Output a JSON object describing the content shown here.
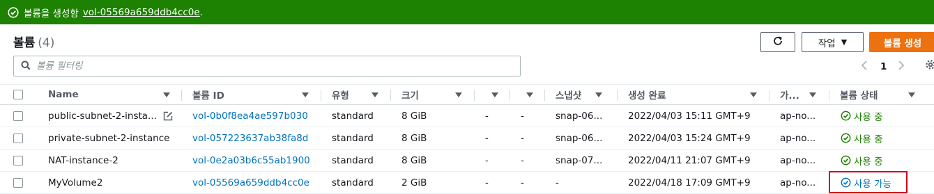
{
  "flash": {
    "message": "볼륨을 생성함",
    "volume_link": "vol-05569a659ddb4cc0e",
    "suffix": "."
  },
  "header": {
    "title": "볼륨",
    "count": "(4)"
  },
  "toolbar": {
    "actions_label": "작업",
    "create_label": "볼륨 생성"
  },
  "search": {
    "placeholder": "볼륨 필터링"
  },
  "pagination": {
    "current": "1"
  },
  "columns": [
    "Name",
    "볼륨 ID",
    "유형",
    "크기",
    "",
    "",
    "스냅샷",
    "생성 완료",
    "가...",
    "볼륨 상태"
  ],
  "rows": [
    {
      "name": "public-subnet-2-insta...",
      "id": "vol-0b0f8ea4ae597b030",
      "type": "standard",
      "size": "8 GiB",
      "c5": "-",
      "c6": "-",
      "snapshot": "snap-06...",
      "created": "2022/04/03 15:11 GMT+9",
      "az": "ap-no...",
      "state": "사용 중"
    },
    {
      "name": "private-subnet-2-instance",
      "id": "vol-057223637ab38fa8d",
      "type": "standard",
      "size": "8 GiB",
      "c5": "-",
      "c6": "-",
      "snapshot": "snap-06...",
      "created": "2022/04/03 15:24 GMT+9",
      "az": "ap-no...",
      "state": "사용 중"
    },
    {
      "name": "NAT-instance-2",
      "id": "vol-0e2a03b6c55ab1900",
      "type": "standard",
      "size": "8 GiB",
      "c5": "-",
      "c6": "-",
      "snapshot": "snap-07...",
      "created": "2022/04/11 21:07 GMT+9",
      "az": "ap-no...",
      "state": "사용 중"
    },
    {
      "name": "MyVolume2",
      "id": "vol-05569a659ddb4cc0e",
      "type": "standard",
      "size": "2 GiB",
      "c5": "-",
      "c6": "-",
      "snapshot": "-",
      "created": "2022/04/18 17:09 GMT+9",
      "az": "ap-no...",
      "state": "사용 가능"
    }
  ],
  "colors": {
    "success": "#1d8102",
    "link": "#0073bb",
    "primary": "#ec7211",
    "highlight": "#d0021b"
  }
}
